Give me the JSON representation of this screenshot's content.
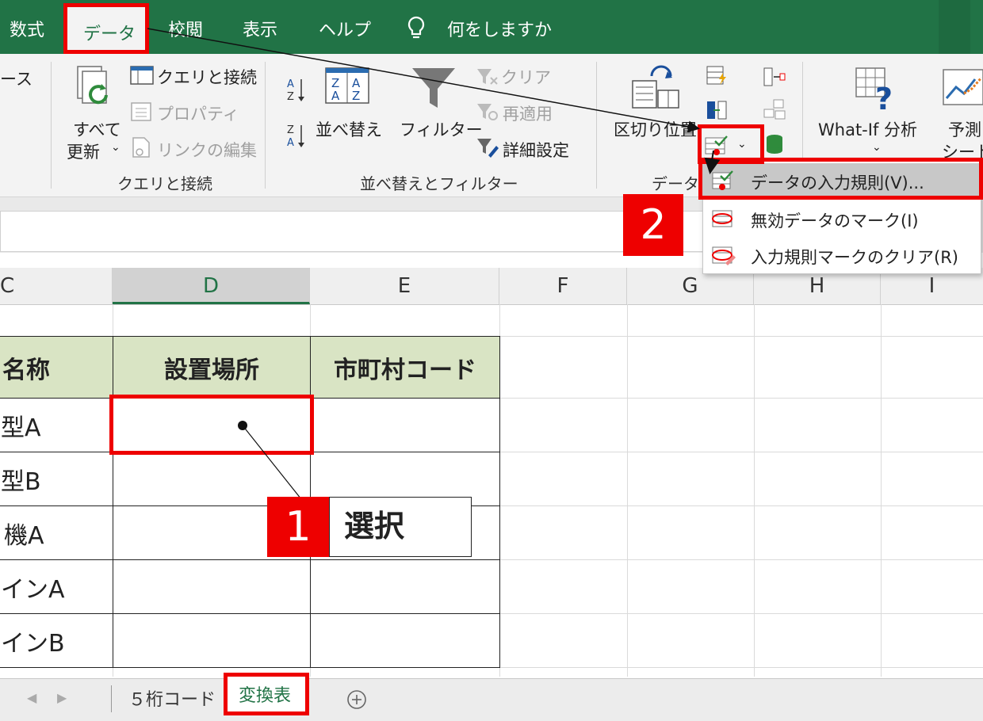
{
  "tabs": {
    "formulas": "数式",
    "data": "データ",
    "review": "校閲",
    "view": "表示",
    "help": "ヘルプ",
    "tell_me": "何をしますか"
  },
  "ribbon": {
    "source_partial": "ース",
    "queries_connections": "クエリと接続",
    "properties": "プロパティ",
    "edit_links": "リンクの編集",
    "refresh_all_line1": "すべて",
    "refresh_all_line2": "更新",
    "group_queries": "クエリと接続",
    "sort": "並べ替え",
    "filter": "フィルター",
    "clear": "クリア",
    "reapply": "再適用",
    "advanced": "詳細設定",
    "group_sort_filter": "並べ替えとフィルター",
    "text_to_columns": "区切り位置",
    "group_data_tools_partial": "データ",
    "what_if": "What-If 分析",
    "forecast_line1": "予測",
    "forecast_line2": "シート"
  },
  "menu": {
    "items": [
      "データの入力規則(V)...",
      "無効データのマーク(I)",
      "入力規則マークのクリア(R)"
    ]
  },
  "columns": [
    "C",
    "D",
    "E",
    "F",
    "G",
    "H",
    "I"
  ],
  "table": {
    "headers": [
      "名称",
      "設置場所",
      "市町村コード"
    ],
    "rows": [
      "型A",
      "型B",
      "機A",
      "インA",
      "インB"
    ]
  },
  "annotations": {
    "step1_number": "1",
    "step1_label": "選択",
    "step2_number": "2"
  },
  "sheets": {
    "tab1": "５桁コード",
    "tab2": "変換表"
  },
  "colors": {
    "excel_green": "#217346",
    "highlight_red": "#e00000",
    "header_fill": "#d9e4c4"
  }
}
